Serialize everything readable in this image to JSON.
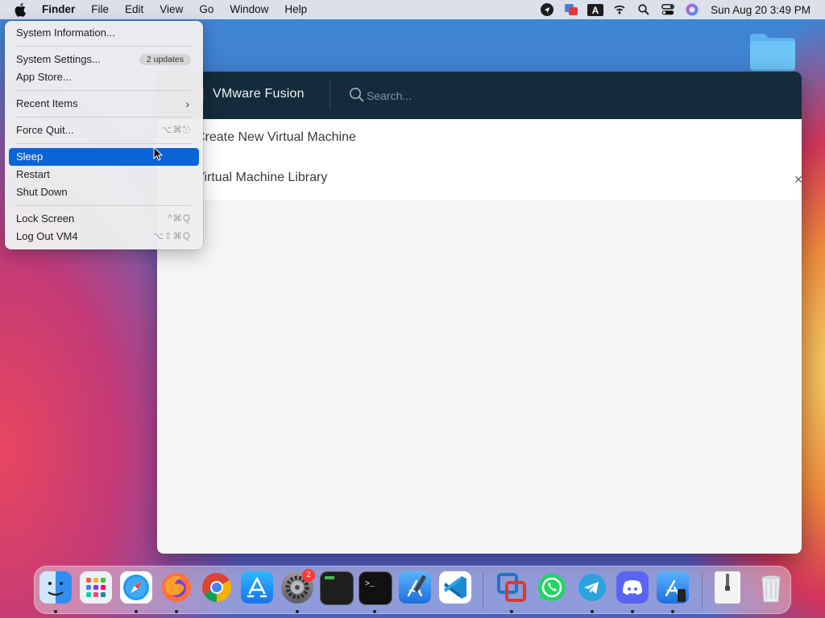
{
  "menubar": {
    "app_name": "Finder",
    "menus": [
      "File",
      "Edit",
      "View",
      "Go",
      "Window",
      "Help"
    ],
    "clock": "Sun Aug 20  3:49 PM",
    "status_icons": [
      "navigation-icon",
      "screenshot-app-icon",
      "input-source-a-icon",
      "wifi-icon",
      "spotlight-search-icon",
      "control-center-icon",
      "siri-icon"
    ]
  },
  "apple_menu": {
    "system_information": "System Information...",
    "system_settings": "System Settings...",
    "updates_badge": "2 updates",
    "app_store": "App Store...",
    "recent_items": "Recent Items",
    "force_quit": "Force Quit...",
    "force_quit_shortcut": "⌥⌘⎋",
    "sleep": "Sleep",
    "restart": "Restart",
    "shut_down": "Shut Down",
    "lock_screen": "Lock Screen",
    "lock_screen_shortcut": "^⌘Q",
    "log_out": "Log Out VM4",
    "log_out_shortcut": "⌥⇧⌘Q"
  },
  "vmware": {
    "title": "VMware Fusion",
    "search_placeholder": "Search...",
    "create_new": "Create New Virtual Machine",
    "library": "Virtual Machine Library"
  },
  "dock": {
    "apps": [
      "Finder",
      "Launchpad",
      "Safari",
      "Firefox",
      "Chrome",
      "App Store",
      "System Settings",
      "Console",
      "Terminal",
      "Xcode",
      "VS Code",
      "VMware Fusion",
      "WhatsApp",
      "Telegram",
      "Discord",
      "Simulator",
      "Archive",
      "Trash"
    ],
    "settings_badge": "2"
  },
  "colors": {
    "highlight": "#0a64d6",
    "vmware_header": "#142b3b",
    "badge_red": "#ff3b30"
  }
}
